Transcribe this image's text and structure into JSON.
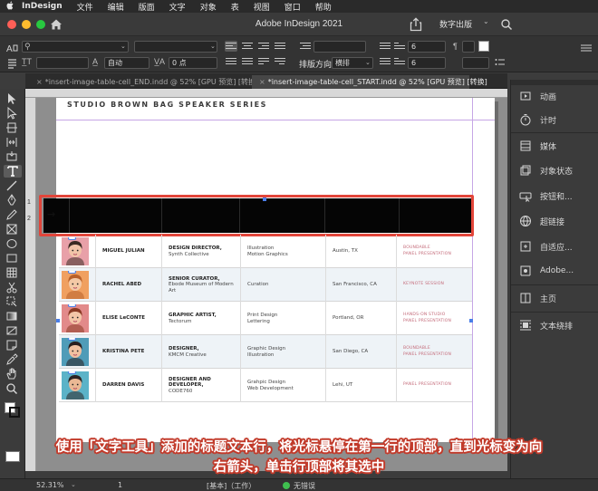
{
  "menubar": {
    "apple": "",
    "items": [
      "InDesign",
      "文件",
      "编辑",
      "版面",
      "文字",
      "对象",
      "表",
      "视图",
      "窗口",
      "帮助"
    ]
  },
  "app": {
    "title": "Adobe InDesign 2021",
    "workspace": "数字出版",
    "traffic_colors": [
      "#ff5f57",
      "#febc2e",
      "#28c840"
    ]
  },
  "controlbar": {
    "font_family": "",
    "font_style": "",
    "leading_mode": "自动",
    "tracking_value": "0 点",
    "columns_value": "6",
    "columns_value_2": "6",
    "row_direction_label": "排版方向",
    "row_direction_value": "横排"
  },
  "tabs": [
    {
      "label": "*insert-image-table-cell_END.indd @ 52% [GPU 预览] [转换]",
      "active": false
    },
    {
      "label": "*insert-image-table-cell_START.indd @ 52% [GPU 预览] [转换]",
      "active": true
    }
  ],
  "ruler": {
    "marks": [
      "1",
      "2"
    ]
  },
  "document": {
    "series_title": "STUDIO BROWN BAG SPEAKER SERIES",
    "header_arrow": "→",
    "rows": [
      {
        "name": "MIGUEL JULIAN",
        "title_bold": "DESIGN DIRECTOR,",
        "title_rest": "Synth Collective",
        "topic1": "Illustration",
        "topic2": "Motion Graphics",
        "city": "Austin, TX",
        "tag1": "BOUNDABLE",
        "tag2": "PANEL PRESENTATION",
        "avatar_bg": "#e8a0a8",
        "hair": "#3a2a22",
        "skin": "#f1c4a8"
      },
      {
        "name": "RACHEL ABED",
        "title_bold": "SENIOR CURATOR,",
        "title_rest": "Ebode Museum of Modern Art",
        "topic1": "Curation",
        "topic2": "",
        "city": "San Francisco, CA",
        "tag1": "KEYNOTE SESSION",
        "tag2": "",
        "avatar_bg": "#f0a060",
        "hair": "#b8602a",
        "skin": "#f4c9a6"
      },
      {
        "name": "ELISE LeCONTE",
        "title_bold": "GRAPHIC ARTIST,",
        "title_rest": "Tectorum",
        "topic1": "Print Design",
        "topic2": "Lettering",
        "city": "Portland, OR",
        "tag1": "HANDS-ON STUDIO",
        "tag2": "PANEL PRESENTATION",
        "avatar_bg": "#e28a8a",
        "hair": "#8a3a24",
        "skin": "#f3c6a8"
      },
      {
        "name": "KRISTINA PETE",
        "title_bold": "DESIGNER,",
        "title_rest": "KMCM Creative",
        "topic1": "Graphic Design",
        "topic2": "Illustration",
        "city": "San Diego, CA",
        "tag1": "BOUNDABLE",
        "tag2": "PANEL PRESENTATION",
        "avatar_bg": "#4f9cb8",
        "hair": "#2a1e1e",
        "skin": "#f0c0a0"
      },
      {
        "name": "DARREN DAVIS",
        "title_bold": "DESIGNER AND DEVELOPER,",
        "title_rest": "CODE760",
        "topic1": "Grahpic Design",
        "topic2": "Web Development",
        "city": "Lehi, UT",
        "tag1": "PANEL PRESENTATION",
        "tag2": "",
        "avatar_bg": "#5bb3c8",
        "hair": "#2c2424",
        "skin": "#eab894"
      }
    ]
  },
  "rpanel": {
    "items": [
      "动画",
      "计时",
      "媒体",
      "对象状态",
      "按钮和...",
      "超链接",
      "自适应...",
      "Adobe...",
      "主页",
      "文本绕排"
    ]
  },
  "statusbar": {
    "zoom": "52.31%",
    "page": "1",
    "mode": "[基本]（工作）",
    "errors": "无错误"
  },
  "caption": {
    "line1": "使用「文字工具」添加的标题文本行，将光标悬停在第一行的顶部，直到光标变为向",
    "line2": "右箭头，单击行顶部将其选中"
  },
  "colors": {
    "highlight": "#e2453a",
    "selection": "#4a7ee8",
    "header_fill": "#050505",
    "tag_pink": "#c46b7a"
  }
}
